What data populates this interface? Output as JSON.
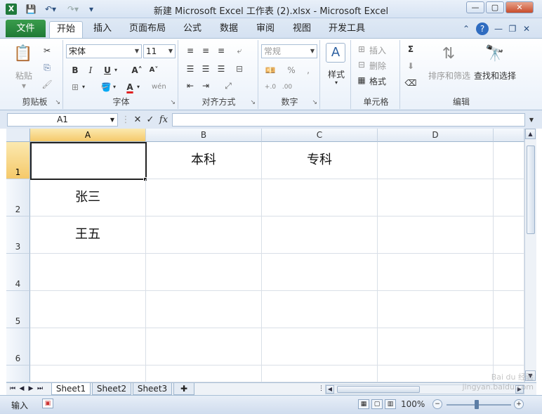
{
  "window": {
    "title": "新建 Microsoft Excel 工作表 (2).xlsx - Microsoft Excel",
    "app_icon": "X",
    "controls": {
      "minimize": "—",
      "maximize": "▢",
      "close": "✕"
    }
  },
  "ribbon_tabs": {
    "file": "文件",
    "items": [
      "开始",
      "插入",
      "页面布局",
      "公式",
      "数据",
      "审阅",
      "视图",
      "开发工具"
    ],
    "active": "开始"
  },
  "clipboard": {
    "paste": "粘贴",
    "label": "剪贴板"
  },
  "font": {
    "name": "宋体",
    "size": "11",
    "label": "字体",
    "color_accent": "#e02020"
  },
  "alignment": {
    "label": "对齐方式"
  },
  "number": {
    "format": "常规",
    "label": "数字",
    "percent": "%",
    "comma": ","
  },
  "styles": {
    "button": "样式"
  },
  "cells": {
    "insert": "插入",
    "delete": "删除",
    "format": "格式",
    "label": "单元格"
  },
  "editing": {
    "sigma": "Σ",
    "sort_filter": "排序和筛选",
    "find_select": "查找和选择",
    "label": "编辑"
  },
  "formula_bar": {
    "name_box": "A1",
    "fx": "fx",
    "cancel": "✕",
    "enter": "✓"
  },
  "sheet": {
    "columns": [
      "A",
      "B",
      "C",
      "D"
    ],
    "rows": [
      "1",
      "2",
      "3",
      "4",
      "5",
      "6"
    ],
    "cells": {
      "A1": "",
      "B1": "本科",
      "C1": "专科",
      "A2": "张三",
      "A3": "王五"
    },
    "active_cell": "A1"
  },
  "sheet_tabs": [
    "Sheet1",
    "Sheet2",
    "Sheet3"
  ],
  "status": {
    "mode": "输入",
    "zoom": "100%"
  },
  "watermark": "Bai du 经验 jingyan.baidu.com"
}
